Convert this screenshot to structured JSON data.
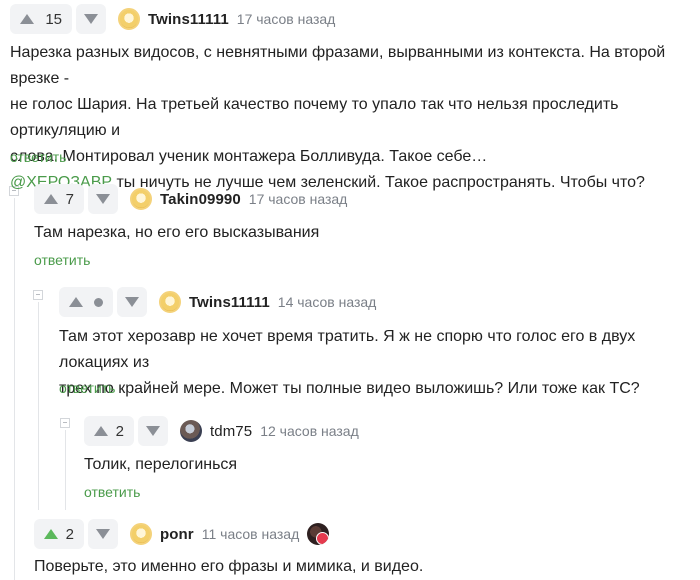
{
  "comments": [
    {
      "score": "15",
      "nick": "Twins11111",
      "time": "17 часов назад",
      "lines": [
        "Нарезка разных видосов, с невнятными фразами, вырванными из контекста. На второй врезке -",
        "не голос Шария. На третьей качество почему то упало так что нельзя проследить ортикуляцию и",
        "слова. Монтировал ученик монтажера Болливуда. Такое себе…"
      ],
      "mention": "@ХЕРОЗАВР",
      "mention_text": " ты ничуть не лучше чем зеленский. Такое распространять. Чтобы что?",
      "reply": "ответить"
    },
    {
      "score": "7",
      "nick": "Takin09990",
      "time": "17 часов назад",
      "lines": [
        "Там нарезка, но его его высказывания"
      ],
      "reply": "ответить"
    },
    {
      "score": "",
      "nick": "Twins11111",
      "time": "14 часов назад",
      "lines": [
        "Там этот херозавр не хочет время тратить. Я ж не спорю что голос его в двух локациях из",
        "трех по крайней мере. Может ты полные видео выложишь? Или тоже как ТС?"
      ],
      "reply": "ответить"
    },
    {
      "score": "2",
      "nick": "tdm75",
      "time": "12 часов назад",
      "lines": [
        "Толик, перелогинься"
      ],
      "reply": "ответить"
    },
    {
      "score": "2",
      "nick": "ponr",
      "time": "11 часов назад",
      "lines": [
        "Поверьте, это именно его фразы и мимика, и видео."
      ]
    }
  ],
  "colors": {
    "accent_green": "#4a9b4a",
    "vote_bg": "#f2f3f5",
    "upvoted": "#5cb85c"
  }
}
